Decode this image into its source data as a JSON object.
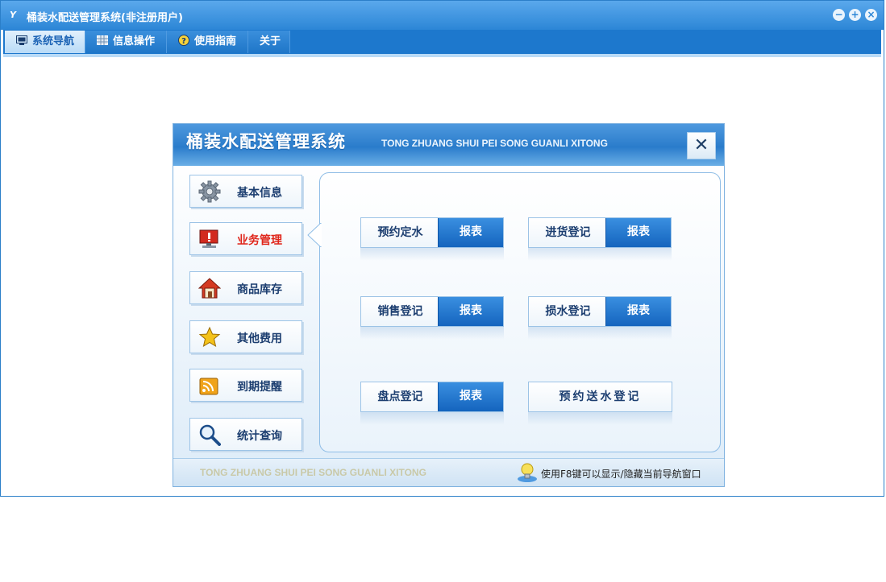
{
  "window": {
    "title": "桶装水配送管理系统(非注册用户)",
    "logo_text": "Y",
    "controls": [
      "minimize-icon",
      "restore-icon",
      "close-icon"
    ]
  },
  "menu": {
    "tabs": [
      {
        "label": "系统导航",
        "icon": "monitor-icon",
        "active": true
      },
      {
        "label": "信息操作",
        "icon": "grid-icon",
        "active": false
      },
      {
        "label": "使用指南",
        "icon": "help-icon",
        "active": false
      },
      {
        "label": "关于",
        "icon": "",
        "active": false
      }
    ]
  },
  "panel": {
    "title": "桶装水配送管理系统",
    "subtitle": "TONG ZHUANG SHUI PEI SONG GUANLI XITONG",
    "close_symbol": "✕",
    "nav": [
      {
        "label": "基本信息",
        "icon": "gear-icon",
        "active": false
      },
      {
        "label": "业务管理",
        "icon": "monitor-alert-icon",
        "active": true
      },
      {
        "label": "商品库存",
        "icon": "home-icon",
        "active": false
      },
      {
        "label": "其他费用",
        "icon": "star-icon",
        "active": false
      },
      {
        "label": "到期提醒",
        "icon": "rss-icon",
        "active": false
      },
      {
        "label": "统计查询",
        "icon": "magnifier-icon",
        "active": false
      }
    ],
    "functions": [
      {
        "label": "预约定水",
        "report": "报表"
      },
      {
        "label": "进货登记",
        "report": "报表"
      },
      {
        "label": "销售登记",
        "report": "报表"
      },
      {
        "label": "损水登记",
        "report": "报表"
      },
      {
        "label": "盘点登记",
        "report": "报表"
      },
      {
        "label": "预约送水登记",
        "report": ""
      }
    ],
    "footer": {
      "brand": "TONG ZHUANG SHUI PEI SONG GUANLI XITONG",
      "hint_icon": "lightbulb-icon",
      "hint": "使用F8键可以显示/隐藏当前导航窗口"
    }
  },
  "colors": {
    "accent": "#1d78cd",
    "active_nav_text": "#e0261b",
    "report_button": "#1a70c8"
  }
}
